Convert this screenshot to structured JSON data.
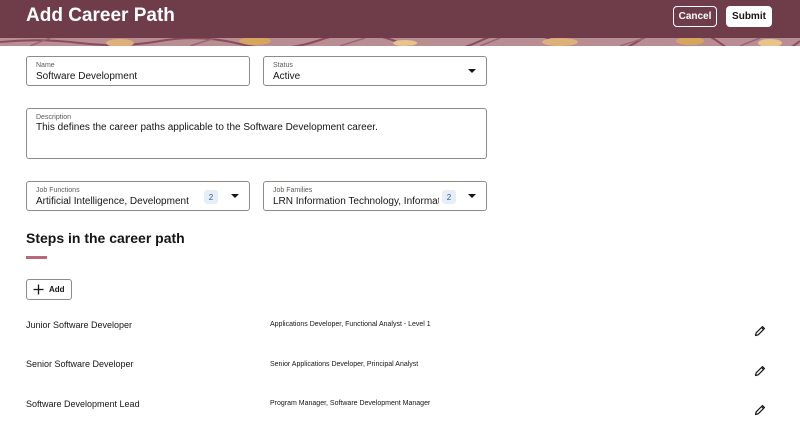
{
  "header": {
    "title": "Add Career Path",
    "cancel_label": "Cancel",
    "submit_label": "Submit"
  },
  "form": {
    "name": {
      "label": "Name",
      "value": "Software Development"
    },
    "status": {
      "label": "Status",
      "value": "Active"
    },
    "description": {
      "label": "Description",
      "value": "This defines the career paths applicable to the Software Development career."
    },
    "job_functions": {
      "label": "Job Functions",
      "value": "Artificial Intelligence, Development",
      "count": "2"
    },
    "job_families": {
      "label": "Job Families",
      "value": "LRN Information Technology, Information Technology",
      "count": "2"
    }
  },
  "steps_section": {
    "title": "Steps in the career path",
    "add_label": "Add",
    "steps": [
      {
        "name": "Junior Software Developer",
        "jobs": "Applications Developer, Functional Analyst - Level 1"
      },
      {
        "name": "Senior Software Developer",
        "jobs": "Senior Applications Developer, Principal Analyst"
      },
      {
        "name": "Software Development Lead",
        "jobs": "Program Manager, Software Development Manager"
      }
    ]
  },
  "icons": {
    "dropdown": "chevron-down-icon",
    "add": "plus-icon",
    "edit": "pencil-icon"
  },
  "colors": {
    "header_bg": "#6f3c4a",
    "accent_underline": "#b76a7c",
    "badge_bg": "#e6eef7",
    "badge_text": "#2f5e8e"
  }
}
